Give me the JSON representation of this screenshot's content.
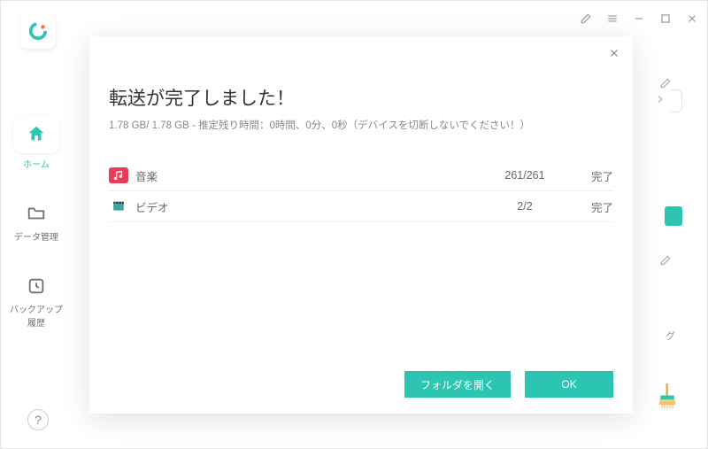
{
  "titlebar": {
    "edit_icon": "edit",
    "menu_icon": "menu",
    "minimize_icon": "minimize",
    "maximize_icon": "maximize",
    "close_icon": "close"
  },
  "sidebar": {
    "items": [
      {
        "label": "ホーム",
        "icon": "home"
      },
      {
        "label": "データ管理",
        "icon": "folder"
      },
      {
        "label": "バックアップ履歴",
        "icon": "backup"
      }
    ]
  },
  "help": {
    "label": "?"
  },
  "background": {
    "tag_text": "グ"
  },
  "modal": {
    "title": "転送が完了しました！",
    "subtitle": "1.78 GB/ 1.78 GB - 推定残り時間：0時間、0分、0秒（デバイスを切断しないでください！）",
    "rows": [
      {
        "icon": "music",
        "label": "音楽",
        "count": "261/261",
        "status": "完了"
      },
      {
        "icon": "video",
        "label": "ビデオ",
        "count": "2/2",
        "status": "完了"
      }
    ],
    "buttons": {
      "open_folder": "フォルダを開く",
      "ok": "OK"
    }
  }
}
